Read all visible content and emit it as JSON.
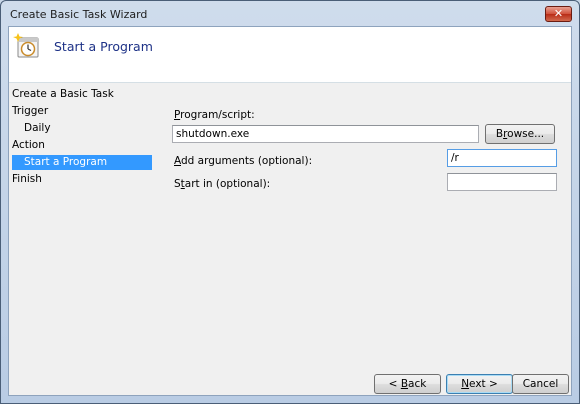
{
  "window": {
    "title": "Create Basic Task Wizard",
    "close_glyph": "✕"
  },
  "header": {
    "title": "Start a Program",
    "icon": "task-clock-icon"
  },
  "nav": {
    "items": [
      {
        "label": "Create a Basic Task",
        "level": 0,
        "selected": false
      },
      {
        "label": "Trigger",
        "level": 0,
        "selected": false
      },
      {
        "label": "Daily",
        "level": 1,
        "selected": false
      },
      {
        "label": "Action",
        "level": 0,
        "selected": false
      },
      {
        "label": "Start a Program",
        "level": 1,
        "selected": true
      },
      {
        "label": "Finish",
        "level": 0,
        "selected": false
      }
    ]
  },
  "form": {
    "program_label_key": "P",
    "program_label_rest": "rogram/script:",
    "program_value": "shutdown.exe",
    "browse_label_key": "r",
    "browse_label_pre": "B",
    "browse_label_post": "owse...",
    "args_label_key": "A",
    "args_label_rest": "dd arguments (optional):",
    "args_value": "/r",
    "start_label_pre": "S",
    "start_label_key": "t",
    "start_label_rest": "art in (optional):",
    "start_value": ""
  },
  "footer": {
    "back_pre": "< ",
    "back_key": "B",
    "back_rest": "ack",
    "next_key": "N",
    "next_rest": "ext >",
    "cancel_label": "Cancel"
  }
}
